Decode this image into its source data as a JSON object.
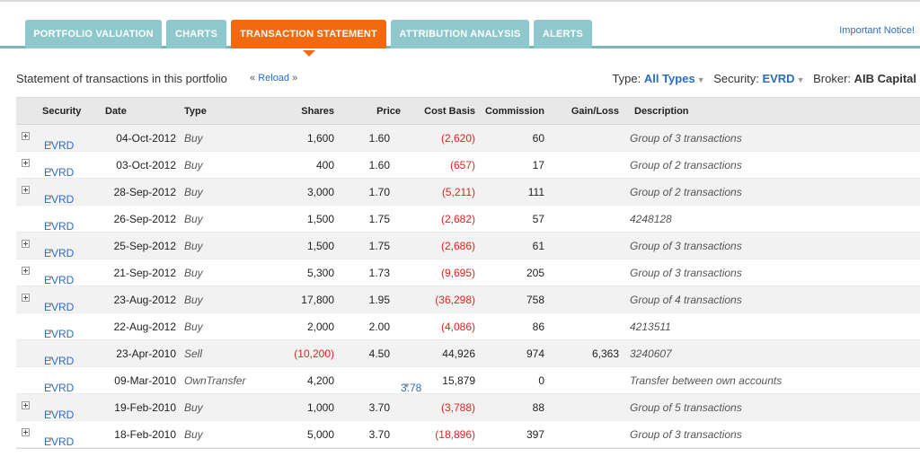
{
  "tabs": [
    {
      "label": "PORTFOLIO VALUATION",
      "active": false
    },
    {
      "label": "CHARTS",
      "active": false
    },
    {
      "label": "TRANSACTION STATEMENT",
      "active": true
    },
    {
      "label": "ATTRIBUTION ANALYSIS",
      "active": false
    },
    {
      "label": "ALERTS",
      "active": false
    }
  ],
  "notice": "Important Notice!",
  "toolbar": {
    "title": "Statement of transactions in this portfolio",
    "reload_prefix": "«",
    "reload_label": "Reload",
    "reload_suffix": "»",
    "type_label": "Type:",
    "type_value": "All Types",
    "security_label": "Security:",
    "security_value": "EVRD",
    "broker_label": "Broker:",
    "broker_value": "AIB Capital"
  },
  "columns": {
    "security": "Security",
    "date": "Date",
    "type": "Type",
    "shares": "Shares",
    "price": "Price",
    "cost_basis": "Cost Basis",
    "commission": "Commission",
    "gain_loss": "Gain/Loss",
    "description": "Description"
  },
  "rows": [
    {
      "expand": true,
      "security": "EVRD",
      "date": "04-Oct-2012",
      "type": "Buy",
      "shares": "1,600",
      "price": "1.60",
      "cost_basis": "(2,620)",
      "commission": "60",
      "gain_loss": "",
      "description": "Group of 3 transactions"
    },
    {
      "expand": true,
      "security": "EVRD",
      "date": "03-Oct-2012",
      "type": "Buy",
      "shares": "400",
      "price": "1.60",
      "cost_basis": "(657)",
      "commission": "17",
      "gain_loss": "",
      "description": "Group of 2 transactions"
    },
    {
      "expand": true,
      "security": "EVRD",
      "date": "28-Sep-2012",
      "type": "Buy",
      "shares": "3,000",
      "price": "1.70",
      "cost_basis": "(5,211)",
      "commission": "111",
      "gain_loss": "",
      "description": "Group of 2 transactions"
    },
    {
      "expand": false,
      "security": "EVRD",
      "date": "26-Sep-2012",
      "type": "Buy",
      "shares": "1,500",
      "price": "1.75",
      "cost_basis": "(2,682)",
      "commission": "57",
      "gain_loss": "",
      "description": "4248128"
    },
    {
      "expand": true,
      "security": "EVRD",
      "date": "25-Sep-2012",
      "type": "Buy",
      "shares": "1,500",
      "price": "1.75",
      "cost_basis": "(2,686)",
      "commission": "61",
      "gain_loss": "",
      "description": "Group of 3 transactions"
    },
    {
      "expand": true,
      "security": "EVRD",
      "date": "21-Sep-2012",
      "type": "Buy",
      "shares": "5,300",
      "price": "1.73",
      "cost_basis": "(9,695)",
      "commission": "205",
      "gain_loss": "",
      "description": "Group of 3 transactions"
    },
    {
      "expand": true,
      "security": "EVRD",
      "date": "23-Aug-2012",
      "type": "Buy",
      "shares": "17,800",
      "price": "1.95",
      "cost_basis": "(36,298)",
      "commission": "758",
      "gain_loss": "",
      "description": "Group of 4 transactions"
    },
    {
      "expand": false,
      "security": "EVRD",
      "date": "22-Aug-2012",
      "type": "Buy",
      "shares": "2,000",
      "price": "2.00",
      "cost_basis": "(4,086)",
      "commission": "86",
      "gain_loss": "",
      "description": "4213511"
    },
    {
      "expand": false,
      "security": "EVRD",
      "date": "23-Apr-2010",
      "type": "Sell",
      "shares": "(10,200)",
      "price": "4.50",
      "cost_basis": "44,926",
      "commission": "974",
      "gain_loss": "6,363",
      "description": "3240607"
    },
    {
      "expand": false,
      "security": "EVRD",
      "date": "09-Mar-2010",
      "type": "OwnTransfer",
      "shares": "4,200",
      "price": "3.78",
      "price_link": true,
      "cost_basis": "15,879",
      "commission": "0",
      "gain_loss": "",
      "description": "Transfer between own accounts"
    },
    {
      "expand": true,
      "security": "EVRD",
      "date": "19-Feb-2010",
      "type": "Buy",
      "shares": "1,000",
      "price": "3.70",
      "cost_basis": "(3,788)",
      "commission": "88",
      "gain_loss": "",
      "description": "Group of 5 transactions"
    },
    {
      "expand": true,
      "security": "EVRD",
      "date": "18-Feb-2010",
      "type": "Buy",
      "shares": "5,000",
      "price": "3.70",
      "cost_basis": "(18,896)",
      "commission": "397",
      "gain_loss": "",
      "description": "Group of 3 transactions"
    }
  ],
  "colors": {
    "tab": "#8ec8cc",
    "tab_active": "#f26a10",
    "link": "#2a6ebd",
    "negative": "#e0241b"
  }
}
